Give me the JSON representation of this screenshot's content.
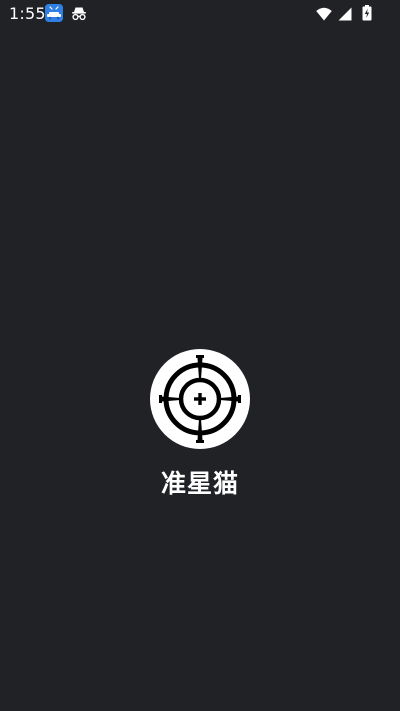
{
  "status_bar": {
    "time": "1:55",
    "icons": [
      "app-notification-icon",
      "incognito-icon",
      "wifi-icon",
      "cell-signal-icon",
      "battery-charging-icon"
    ]
  },
  "splash": {
    "logo_icon": "crosshair-icon",
    "app_name": "准星猫"
  },
  "colors": {
    "background": "#212226",
    "foreground": "#ffffff",
    "notification_icon": "#2f80e4"
  }
}
